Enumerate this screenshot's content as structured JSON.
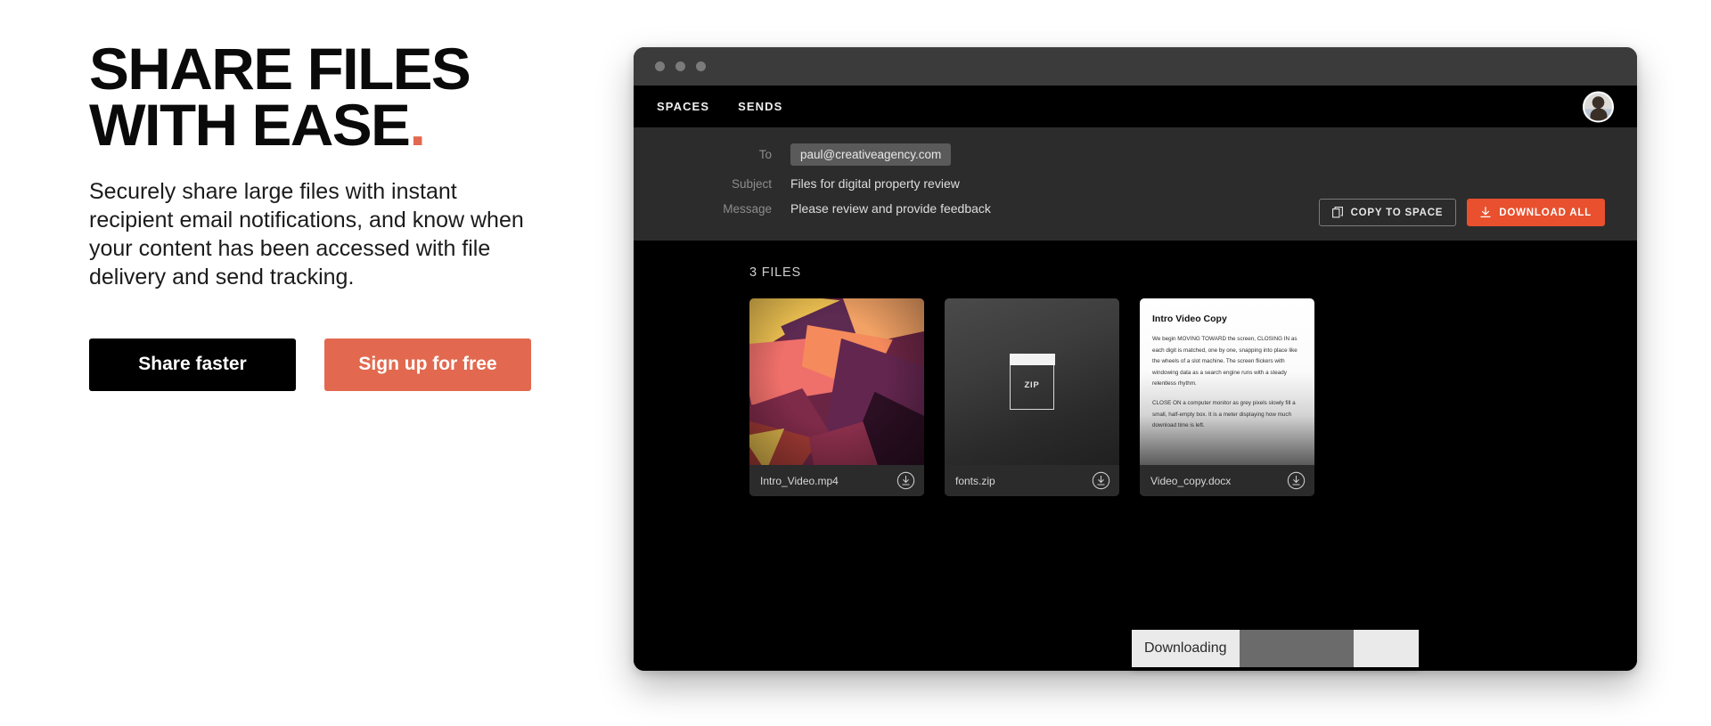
{
  "hero": {
    "title_line1": "SHARE FILES",
    "title_line2": "WITH EASE",
    "title_accent": ".",
    "subtitle": "Securely share large files with instant recipient email notifications, and know when your content has been accessed with file delivery and send tracking.",
    "primary_button": "Share faster",
    "secondary_button": "Sign up for free",
    "accent_color": "#E2694F"
  },
  "app": {
    "nav": {
      "items": [
        {
          "label": "SPACES"
        },
        {
          "label": "SENDS"
        }
      ],
      "avatar_alt": "user-avatar"
    },
    "compose": {
      "fields": [
        {
          "label": "To",
          "value": "paul@creativeagency.com",
          "style": "chip"
        },
        {
          "label": "Subject",
          "value": "Files for digital property review",
          "style": "text"
        },
        {
          "label": "Message",
          "value": "Please review and provide feedback",
          "style": "text"
        }
      ],
      "actions": {
        "copy_label": "COPY TO SPACE",
        "download_label": "DOWNLOAD ALL",
        "download_color": "#E8502E"
      }
    },
    "files": {
      "count_label": "3 FILES",
      "items": [
        {
          "name": "Intro_Video.mp4",
          "preview_type": "image",
          "preview_text": ""
        },
        {
          "name": "fonts.zip",
          "preview_type": "zip",
          "preview_text": "ZIP"
        },
        {
          "name": "Video_copy.docx",
          "preview_type": "document",
          "doc_title": "Intro Video Copy",
          "doc_paragraph1": "We begin MOVING TOWARD the screen, CLOSING IN as each digit is matched, one by one, snapping into place like the wheels of a slot machine. The screen flickers with windowing data as a search engine runs with a steady relentless rhythm.",
          "doc_paragraph2": "CLOSE ON a computer monitor as grey pixels slowly fill a small, half-empty box. It is a meter displaying how much download time is left."
        }
      ]
    },
    "download_toast": {
      "label": "Downloading",
      "progress_percent": 64
    }
  }
}
